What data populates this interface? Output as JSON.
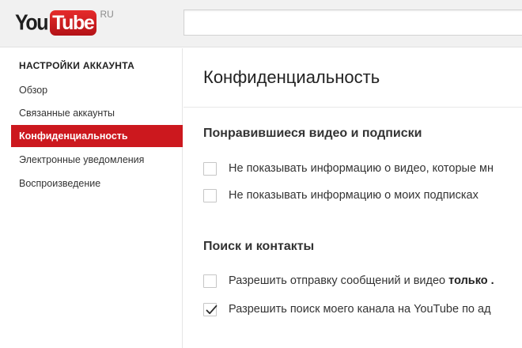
{
  "header": {
    "logo_you": "You",
    "logo_tube": "Tube",
    "logo_region": "RU",
    "search_value": ""
  },
  "sidebar": {
    "heading": "НАСТРОЙКИ АККАУНТА",
    "items": [
      {
        "label": "Обзор",
        "active": false
      },
      {
        "label": "Связанные аккаунты",
        "active": false
      },
      {
        "label": "Конфиденциальность",
        "active": true
      },
      {
        "label": "Электронные уведомления",
        "active": false
      },
      {
        "label": "Воспроизведение",
        "active": false
      }
    ]
  },
  "main": {
    "title": "Конфиденциальность",
    "sections": [
      {
        "title": "Понравившиеся видео и подписки",
        "options": [
          {
            "label": "Не показывать информацию о видео, которые мн",
            "checked": false
          },
          {
            "label": "Не показывать информацию о моих подписках",
            "checked": false
          }
        ]
      },
      {
        "title": "Поиск и контакты",
        "options": [
          {
            "label": "Разрешить отправку сообщений и видео ",
            "label_bold": "только .",
            "checked": false
          },
          {
            "label": "Разрешить поиск моего канала на YouTube по ад",
            "checked": true
          }
        ]
      }
    ]
  },
  "colors": {
    "brand_red": "#cc181e",
    "header_bg": "#f1f1f1",
    "checkmark": "#2a2a2a"
  },
  "icons": {
    "checkmark": "check-icon"
  }
}
